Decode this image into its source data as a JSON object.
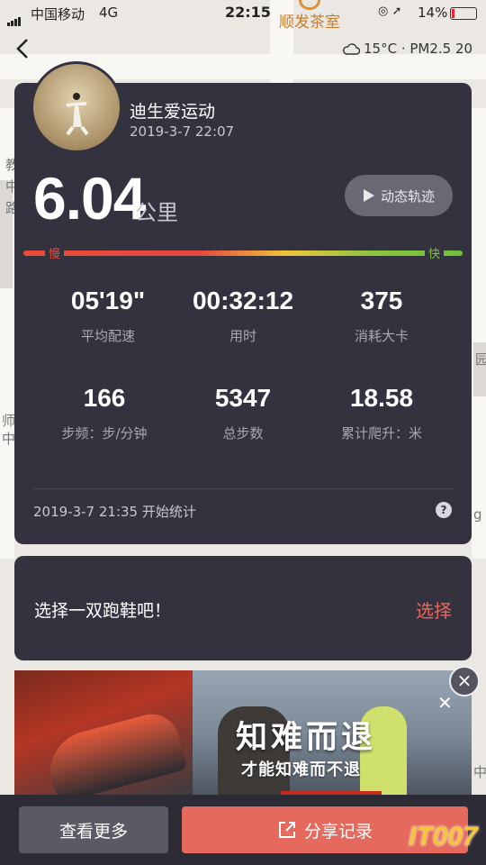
{
  "status_bar": {
    "carrier": "中国移动",
    "network": "4G",
    "time": "22:15",
    "battery": "14%",
    "battery_color": "#e23333"
  },
  "map": {
    "poi_label": "顺发茶室",
    "side_chars": [
      "教",
      "中",
      "路",
      "师",
      "中",
      "园",
      "g",
      "中"
    ]
  },
  "weather": {
    "icon": "cloud-icon",
    "text": "15°C · PM2.5 20"
  },
  "record": {
    "user_name": "迪生爱运动",
    "datetime": "2019-3-7 22:07",
    "distance": "6.04",
    "distance_unit": "公里",
    "track_button": "动态轨迹",
    "pace_slow": "慢",
    "pace_fast": "快",
    "stats": [
      {
        "value": "05'19\"",
        "label": "平均配速"
      },
      {
        "value": "00:32:12",
        "label": "用时"
      },
      {
        "value": "375",
        "label": "消耗大卡"
      },
      {
        "value": "166",
        "label": "步频：步/分钟"
      },
      {
        "value": "5347",
        "label": "总步数"
      },
      {
        "value": "18.58",
        "label": "累计爬升：米"
      }
    ],
    "start_text": "2019-3-7 21:35 开始统计",
    "help": "?"
  },
  "shoe": {
    "prompt": "选择一双跑鞋吧！",
    "select": "选择"
  },
  "ad": {
    "headline": "知难而退",
    "subline": "才能知难而不退",
    "close": "×"
  },
  "actions": {
    "more": "查看更多",
    "share": "分享记录"
  },
  "watermark": "IT007",
  "colors": {
    "card_bg": "#34323f",
    "accent": "#e5695c",
    "slow": "#e74c3c",
    "fast": "#7cc43f"
  }
}
